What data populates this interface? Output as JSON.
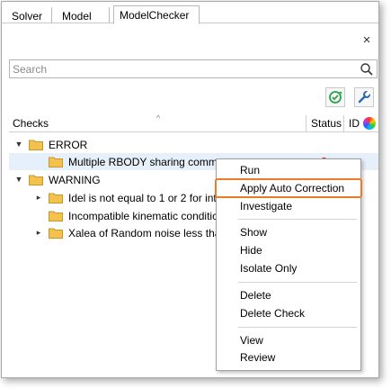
{
  "tabs": [
    {
      "label": "Solver",
      "active": false
    },
    {
      "label": "Model",
      "active": false
    },
    {
      "label": "ModelChecker",
      "active": true
    }
  ],
  "close_label": "×",
  "search": {
    "placeholder": "Search",
    "value": ""
  },
  "toolbar": [
    {
      "icon": "auto-correct-icon"
    },
    {
      "icon": "wrench-icon"
    }
  ],
  "table_header": {
    "checks": "Checks",
    "status": "Status",
    "id": "ID",
    "sort_glyph": "^"
  },
  "tree": [
    {
      "label": "ERROR",
      "level": 0,
      "expanded": true,
      "status": ""
    },
    {
      "label": "Multiple RBODY sharing comm",
      "level": 1,
      "expanded": null,
      "status": "error"
    },
    {
      "label": "WARNING",
      "level": 0,
      "expanded": true,
      "status": ""
    },
    {
      "label": "Idel is not equal to 1 or 2 for int",
      "level": 1,
      "expanded": false,
      "status": ""
    },
    {
      "label": "Incompatible kinematic conditic",
      "level": 1,
      "expanded": null,
      "status": ""
    },
    {
      "label": "Xalea of Random noise less tha",
      "level": 1,
      "expanded": false,
      "status": ""
    }
  ],
  "context_menu": {
    "items": [
      {
        "label": "Run"
      },
      {
        "label": "Apply Auto Correction",
        "highlighted": true
      },
      {
        "label": "Investigate"
      },
      {
        "label": "Show"
      },
      {
        "label": "Hide"
      },
      {
        "label": "Isolate Only"
      },
      {
        "label": "Delete"
      },
      {
        "label": "Delete Check"
      },
      {
        "label": "View"
      },
      {
        "label": "Review"
      }
    ]
  },
  "colors": {
    "highlight_border": "#ec7a2b",
    "folder": "#f2c14e",
    "error_status": "#e01010",
    "selected_row": "#e6f0fb"
  }
}
